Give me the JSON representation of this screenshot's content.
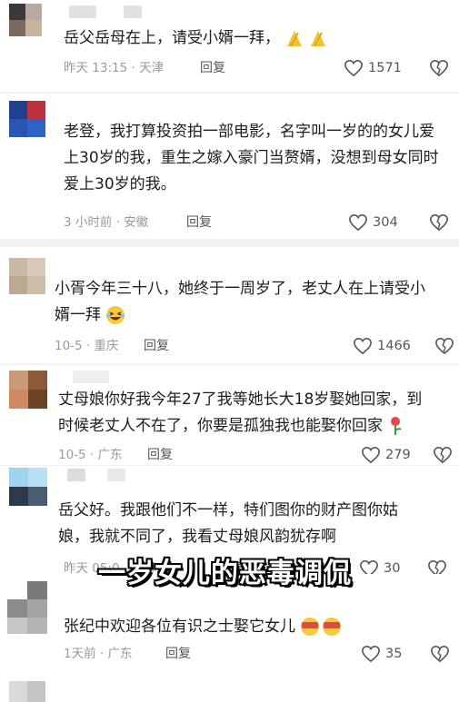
{
  "comments": [
    {
      "text": "岳父岳母在上，请受小婿一拜，",
      "time": "昨天 13:15 · 天津",
      "reply": "回复",
      "likes": "1571"
    },
    {
      "text": "老登，我打算投资拍一部电影，名字叫一岁的的女儿爱上30岁的我，重生之嫁入豪门当赘婿，没想到母女同时爱上30岁的我。",
      "time": "3 小时前 · 安徽",
      "reply": "回复",
      "likes": "304"
    },
    {
      "text": "小胥今年三十八，她终于一周岁了，老丈人在上请受小婿一拜",
      "time": "10-5 · 重庆",
      "reply": "回复",
      "likes": "1466"
    },
    {
      "text": "丈母娘你好我今年27了我等她长大18岁娶她回家，到时候老丈人不在了，你要是孤独我也能娶你回家",
      "time": "10-5 · 广东",
      "reply": "回复",
      "likes": "279"
    },
    {
      "text": "岳父好。我跟他们不一样，特们图你的财产图你姑娘，我就不同了，我看丈母娘风韵犹存啊",
      "time": "昨天 05:0…江苏",
      "reply": "回复",
      "likes": "30"
    },
    {
      "text": "张纪中欢迎各位有识之士娶它女儿",
      "time": "1天前 · 广东",
      "reply": "回复",
      "likes": "35"
    }
  ],
  "overlay_caption": "一岁女儿的恶毒调侃",
  "colors": {
    "text": "#1c1c1c",
    "meta": "#9a9a9a",
    "divider": "#f2f2f2"
  }
}
